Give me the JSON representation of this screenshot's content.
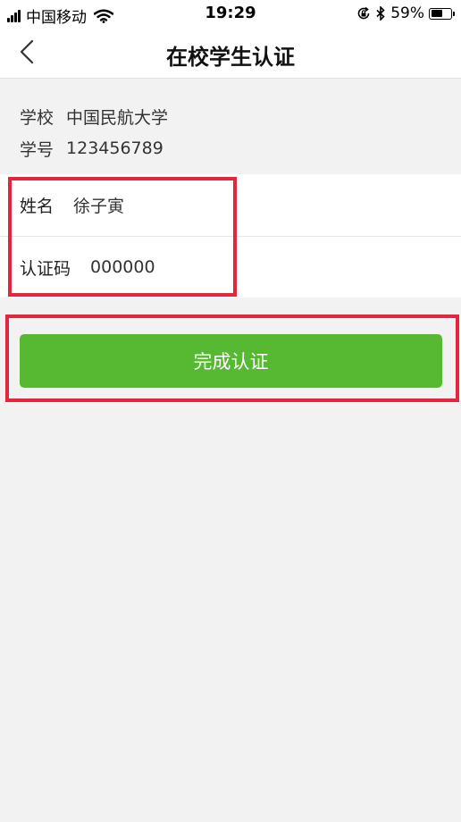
{
  "status_bar": {
    "carrier": "中国移动",
    "time": "19:29",
    "battery_percent": "59%",
    "battery_level": 0.59,
    "icons": [
      "signal-icon",
      "wifi-icon",
      "lock-rotation-icon",
      "bluetooth-icon",
      "battery-icon"
    ]
  },
  "nav": {
    "title": "在校学生认证",
    "back_icon": "chevron-left-icon"
  },
  "school_info": {
    "school_label": "学校",
    "school_value": "中国民航大学",
    "id_label": "学号",
    "id_value": "123456789"
  },
  "form": {
    "name_label": "姓名",
    "name_value": "徐子寅",
    "code_label": "认证码",
    "code_value": "000000"
  },
  "submit": {
    "label": "完成认证"
  },
  "colors": {
    "accent_green": "#57b832",
    "highlight_red": "#e3263e",
    "background": "#f2f2f2"
  }
}
